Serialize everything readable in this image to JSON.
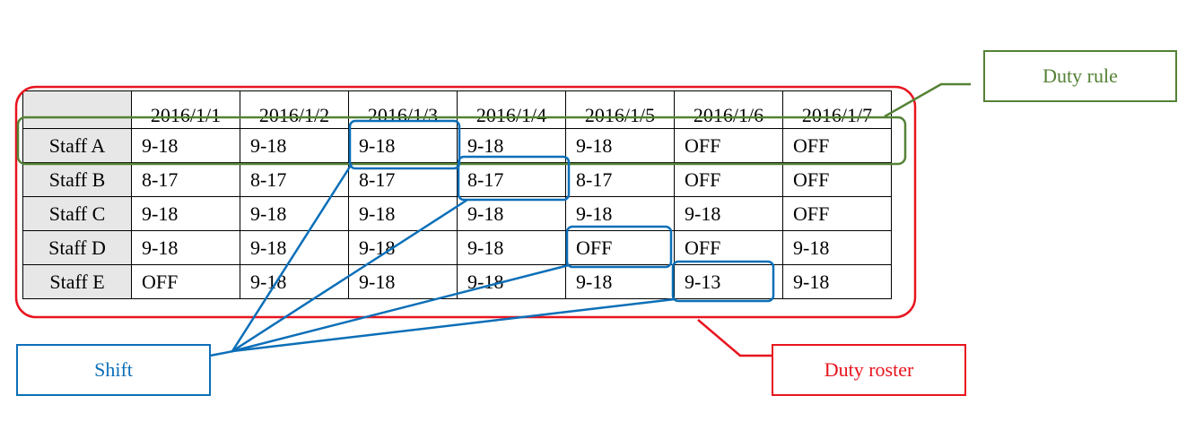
{
  "colors": {
    "roster": "#e8141e",
    "rule": "#548235",
    "shift": "#0b6fb8",
    "header_fill": "#e7e7e7",
    "grid": "#000000"
  },
  "table": {
    "dates": [
      "2016/1/1",
      "2016/1/2",
      "2016/1/3",
      "2016/1/4",
      "2016/1/5",
      "2016/1/6",
      "2016/1/7"
    ],
    "rows": [
      {
        "staff": "Staff A",
        "shifts": [
          "9-18",
          "9-18",
          "9-18",
          "9-18",
          "9-18",
          "OFF",
          "OFF"
        ]
      },
      {
        "staff": "Staff B",
        "shifts": [
          "8-17",
          "8-17",
          "8-17",
          "8-17",
          "8-17",
          "OFF",
          "OFF"
        ]
      },
      {
        "staff": "Staff C",
        "shifts": [
          "9-18",
          "9-18",
          "9-18",
          "9-18",
          "9-18",
          "9-18",
          "OFF"
        ]
      },
      {
        "staff": "Staff D",
        "shifts": [
          "9-18",
          "9-18",
          "9-18",
          "9-18",
          "OFF",
          "OFF",
          "9-18"
        ]
      },
      {
        "staff": "Staff E",
        "shifts": [
          "OFF",
          "9-18",
          "9-18",
          "9-18",
          "9-18",
          "9-13",
          "9-18"
        ]
      }
    ]
  },
  "labels": {
    "duty_rule": "Duty rule",
    "shift": "Shift",
    "duty_roster": "Duty roster"
  }
}
